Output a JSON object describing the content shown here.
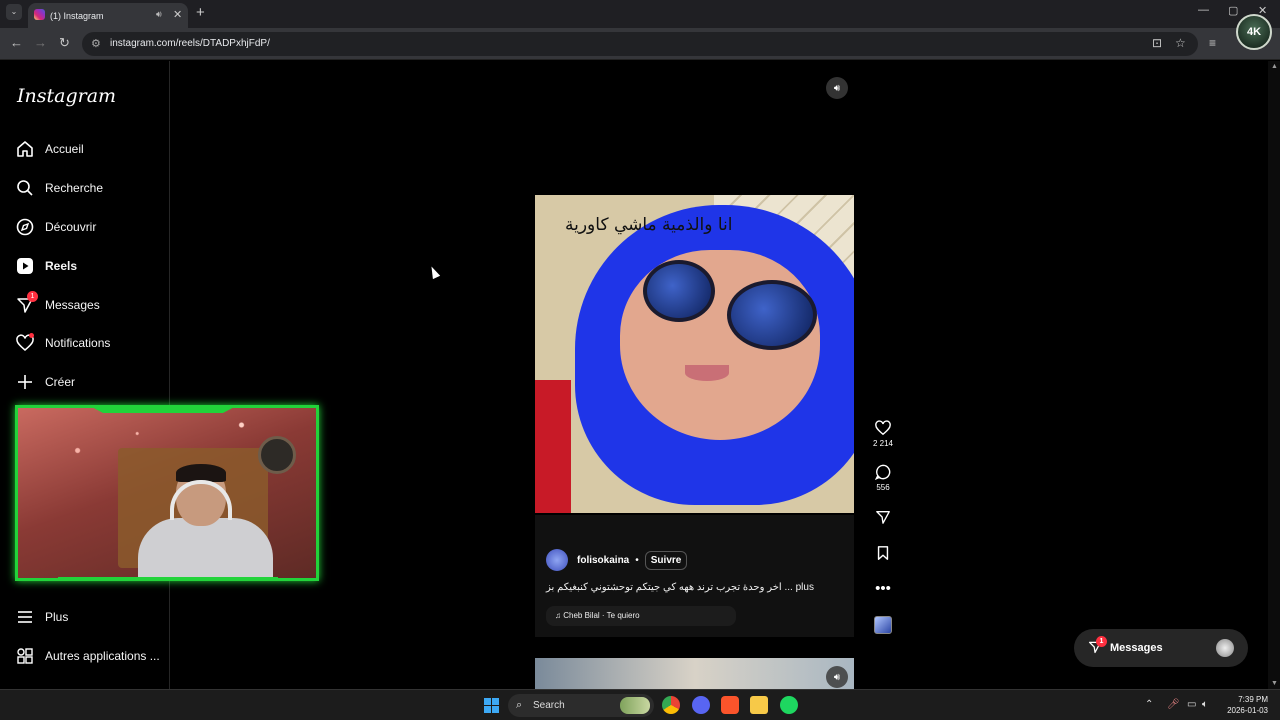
{
  "browser": {
    "tab_title": "(1) Instagram",
    "url": "instagram.com/reels/DTADPxhjFdP/",
    "icons": [
      "tab-list-icon",
      "instagram-favicon",
      "speaker-icon",
      "close-tab-icon",
      "new-tab-icon",
      "back-icon",
      "forward-icon",
      "reload-icon",
      "site-info-icon",
      "install-app-icon",
      "bookmark-star-icon",
      "media-control-icon",
      "minimize-icon",
      "maximize-icon",
      "close-window-icon"
    ],
    "profile_badge": "4K"
  },
  "sidebar": {
    "logo": "Instagram",
    "items": [
      {
        "label": "Accueil",
        "icon": "home-icon"
      },
      {
        "label": "Recherche",
        "icon": "search-icon"
      },
      {
        "label": "Découvrir",
        "icon": "compass-icon"
      },
      {
        "label": "Reels",
        "icon": "reels-icon",
        "active": true
      },
      {
        "label": "Messages",
        "icon": "messages-icon",
        "badge": "1"
      },
      {
        "label": "Notifications",
        "icon": "heart-icon"
      },
      {
        "label": "Créer",
        "icon": "plus-icon"
      }
    ],
    "bottom_items": [
      {
        "label": "Plus",
        "icon": "menu-icon"
      },
      {
        "label": "Autres applications ...",
        "icon": "apps-icon"
      }
    ]
  },
  "reel": {
    "overlay_text": "انا والذمية ماشي كاورية",
    "author": "folisokaina",
    "separator": "•",
    "follow_label": "Suivre",
    "description": "اخر وحدة تجرب ترند ههه كي جيتكم توحشتوني كنبغيكم بز ... plus",
    "music": "Cheb Bilal · Te quiero",
    "likes": "2 214",
    "comments": "556"
  },
  "messages_pill": {
    "label": "Messages",
    "badge": "1"
  },
  "taskbar": {
    "search_label": "Search",
    "time": "7:39 PM",
    "date": "2026-01-03"
  },
  "colors": {
    "accent_green": "#22d33a",
    "badge_red": "#ff3040",
    "background": "#000000"
  }
}
